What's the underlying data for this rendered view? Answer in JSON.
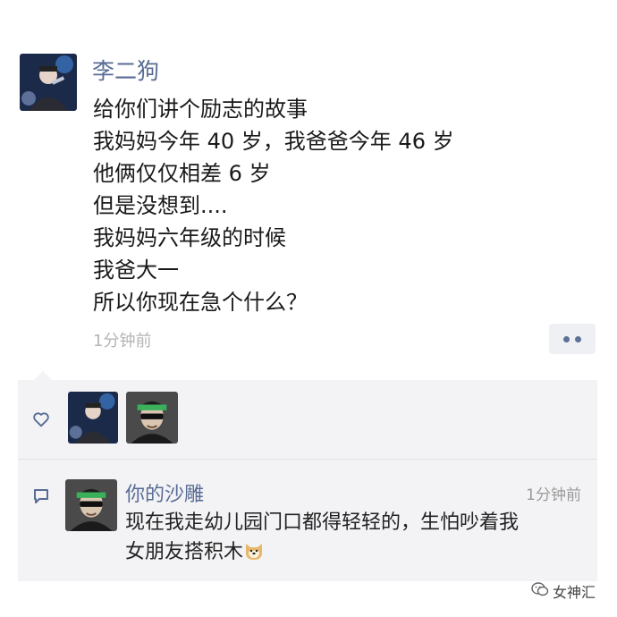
{
  "post": {
    "author": "李二狗",
    "lines": [
      "给你们讲个励志的故事",
      "我妈妈今年 40 岁，我爸爸今年 46 岁",
      "他俩仅仅相差 6 岁",
      "但是没想到....",
      "我妈妈六年级的时候",
      "我爸大一",
      "所以你现在急个什么？"
    ],
    "timestamp": "1分钟前"
  },
  "likes": {
    "icon": "heart-icon",
    "avatars": [
      "avatar-lieergou",
      "avatar-nideshadiao"
    ]
  },
  "comment": {
    "icon": "comment-icon",
    "author": "你的沙雕",
    "time": "1分钟前",
    "lines": [
      "现在我走幼儿园门口都得轻轻的，生怕吵着我",
      "女朋友搭积木"
    ],
    "emoji": "shiba-emoji"
  },
  "watermark": {
    "text": "女神汇",
    "icon": "wechat-icon"
  },
  "colors": {
    "name_link": "#586b95",
    "interaction_bg": "#f3f3f5",
    "timestamp": "#b4b4b4"
  }
}
